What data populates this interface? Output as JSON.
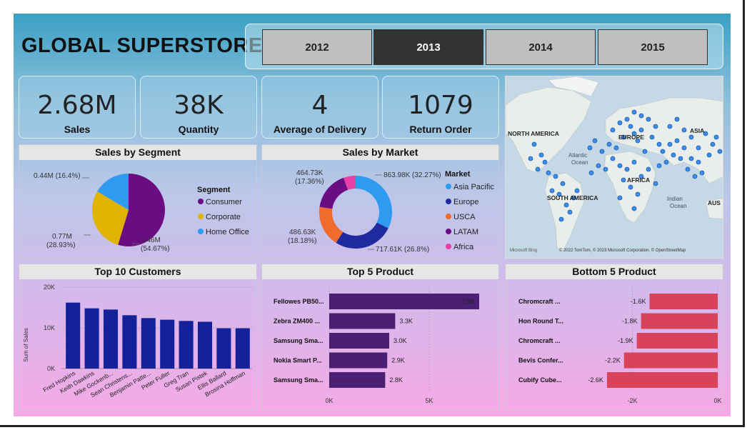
{
  "title": "GLOBAL SUPERSTORE",
  "years": [
    "2012",
    "2013",
    "2014",
    "2015"
  ],
  "selected_year": "2013",
  "kpis": [
    {
      "value": "2.68M",
      "label": "Sales"
    },
    {
      "value": "38K",
      "label": "Quantity"
    },
    {
      "value": "4",
      "label": "Average of Delivery"
    },
    {
      "value": "1079",
      "label": "Return Order"
    }
  ],
  "segment": {
    "title": "Sales by Segment",
    "legend_title": "Segment",
    "labels": {
      "consumer": "1.46M\n(54.67%)",
      "corporate": "0.77M\n(28.93%)",
      "home": "0.44M (16.4%)"
    },
    "chart_data": {
      "type": "pie",
      "categories": [
        "Consumer",
        "Corporate",
        "Home Office"
      ],
      "values": [
        1.46,
        0.77,
        0.44
      ],
      "colors": [
        "#6a0d83",
        "#e0b300",
        "#2f9bf0"
      ]
    }
  },
  "market": {
    "title": "Sales by Market",
    "legend_title": "Market",
    "labels": {
      "asia": "863.98K (32.27%)",
      "europe": "717.61K (26.8%)",
      "usca": "486.63K\n(18.18%)",
      "latam": "464.73K\n(17.36%)"
    },
    "chart_data": {
      "type": "pie",
      "categories": [
        "Asia Pacific",
        "Europe",
        "USCA",
        "LATAM",
        "Africa"
      ],
      "values": [
        863.98,
        717.61,
        486.63,
        464.73,
        144.0
      ],
      "colors": [
        "#2f9bf0",
        "#1f2aa0",
        "#f06b2c",
        "#6a0d83",
        "#e83fa6"
      ]
    }
  },
  "map": {
    "labels": [
      "NORTH AMERICA",
      "EUROPE",
      "ASIA",
      "AFRICA",
      "SOUTH AMERICA",
      "Atlantic\nOcean",
      "Indian\nOcean",
      "AUS"
    ],
    "attribution": "© 2022 TomTom, © 2023 Microsoft Corporation, © OpenStreetMap",
    "brand": "Microsoft Bing"
  },
  "customers": {
    "title": "Top 10 Customers",
    "ylabel": "Sum of Sales",
    "chart_data": {
      "type": "bar",
      "categories": [
        "Fred Hopkins",
        "Keith Dawkins",
        "Mike Gockenb...",
        "Sean Christens...",
        "Benjamin Patte...",
        "Peter Fuller",
        "Greg Tran",
        "Susan Pistek",
        "Ellis Ballard",
        "Brosina Hoffman"
      ],
      "values": [
        16.2,
        14.8,
        14.5,
        13.1,
        12.4,
        12.0,
        11.7,
        11.5,
        9.9,
        9.9
      ],
      "ylim": [
        0,
        20
      ],
      "yticks": [
        "0K",
        "10K",
        "20K"
      ],
      "color": "#13229a"
    }
  },
  "top5": {
    "title": "Top 5 Product",
    "chart_data": {
      "type": "bar",
      "categories": [
        "Fellowes PB50...",
        "Zebra ZM400 ...",
        "Samsung Sma...",
        "Nokia Smart P...",
        "Samsung Sma..."
      ],
      "values": [
        7.5,
        3.3,
        3.0,
        2.9,
        2.8
      ],
      "value_labels": [
        "7.5K",
        "3.3K",
        "3.0K",
        "2.9K",
        "2.8K"
      ],
      "xticks": [
        "0K",
        "5K"
      ],
      "xlim": [
        0,
        8
      ],
      "color": "#4b1f73"
    }
  },
  "bottom5": {
    "title": "Bottom 5 Product",
    "chart_data": {
      "type": "bar",
      "categories": [
        "Chromcraft ...",
        "Hon Round T...",
        "Chromcraft ...",
        "Bevis Confer...",
        "Cubify Cube..."
      ],
      "values": [
        -1.6,
        -1.8,
        -1.9,
        -2.2,
        -2.6
      ],
      "value_labels": [
        "-1.6K",
        "-1.8K",
        "-1.9K",
        "-2.2K",
        "-2.6K"
      ],
      "xticks": [
        "-2K",
        "0K"
      ],
      "xlim": [
        -3,
        0
      ],
      "color": "#d9435a"
    }
  }
}
